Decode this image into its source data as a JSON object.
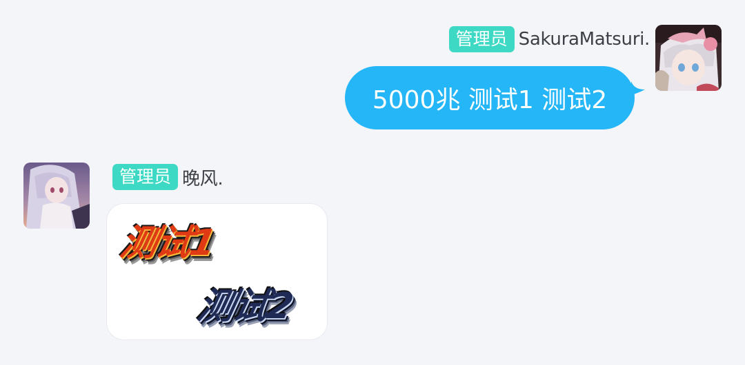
{
  "messages": [
    {
      "direction": "outgoing",
      "sender": {
        "role_badge": "管理员",
        "nickname": "SakuraMatsuri.",
        "avatar_icon": "anime-girl-avatar-icon"
      },
      "text": "5000兆 测试1 测试2"
    },
    {
      "direction": "incoming",
      "sender": {
        "role_badge": "管理员",
        "nickname": "晚风.",
        "avatar_icon": "anime-girl-avatar-icon"
      },
      "image": {
        "lines": [
          "测试1",
          "测试2"
        ],
        "line_colors": [
          "#e03a14",
          "#1f2a55"
        ]
      }
    }
  ],
  "colors": {
    "background": "#f3f5f9",
    "bubble_out": "#25b6f7",
    "role_badge": "#3dd9c5",
    "nickname": "#3c3f45"
  }
}
